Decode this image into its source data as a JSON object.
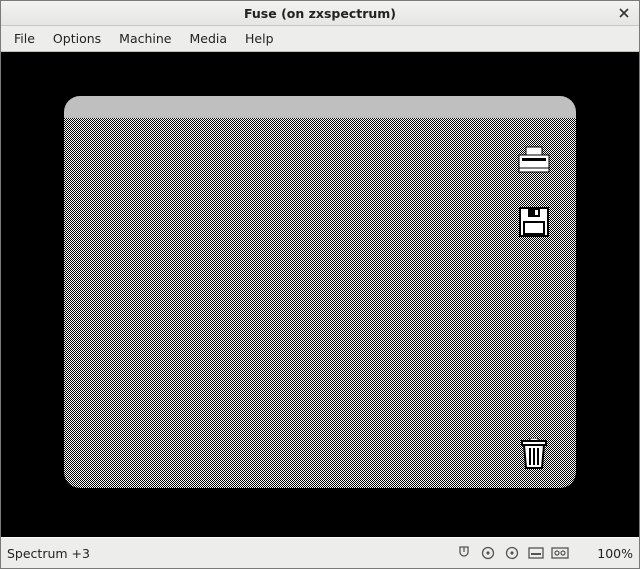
{
  "window": {
    "title": "Fuse  (on zxspectrum)"
  },
  "menu": {
    "file": "File",
    "options": "Options",
    "machine": "Machine",
    "media": "Media",
    "help": "Help"
  },
  "status": {
    "machine": "Spectrum +3",
    "speed": "100%"
  },
  "icons": {
    "close": "close-icon",
    "printer": "printer-icon",
    "floppy": "floppy-icon",
    "trash": "trash-icon",
    "mouse": "mouse-icon",
    "disk_a": "disk-a-icon",
    "disk_b": "disk-b-icon",
    "mdr": "microdrive-icon",
    "tape": "tape-icon"
  }
}
